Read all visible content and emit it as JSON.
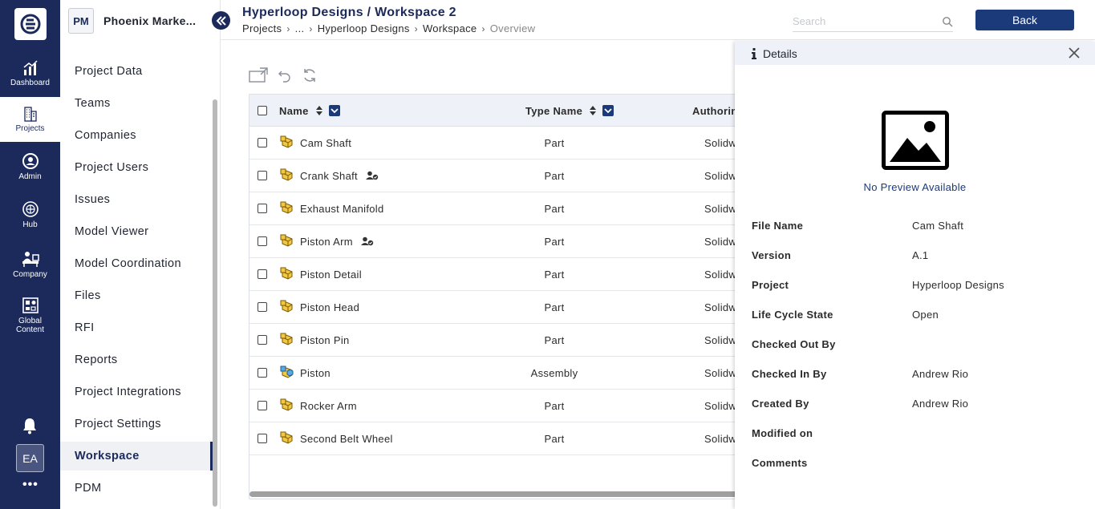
{
  "rail": {
    "items": [
      {
        "label": "Dashboard",
        "icon": "chart-icon"
      },
      {
        "label": "Projects",
        "icon": "building-icon"
      },
      {
        "label": "Admin",
        "icon": "admin-icon"
      },
      {
        "label": "Hub",
        "icon": "globe-icon"
      },
      {
        "label": "Company",
        "icon": "company-icon"
      },
      {
        "label": "Global Content",
        "icon": "grid-icon"
      }
    ],
    "avatar": "EA",
    "more": "•••"
  },
  "project": {
    "initials": "PM",
    "name": "Phoenix Marke..."
  },
  "nav": {
    "items": [
      "Project Data",
      "Teams",
      "Companies",
      "Project Users",
      "Issues",
      "Model Viewer",
      "Model Coordination",
      "Files",
      "RFI",
      "Reports",
      "Project Integrations",
      "Project Settings",
      "Workspace",
      "PDM"
    ],
    "active": "Workspace"
  },
  "header": {
    "title": "Hyperloop Designs / Workspace 2",
    "breadcrumb": [
      "Projects",
      "...",
      "Hyperloop Designs",
      "Workspace",
      "Overview"
    ],
    "search_placeholder": "Search",
    "back_label": "Back"
  },
  "table": {
    "columns": [
      "Name",
      "Type Name",
      "Authoring"
    ],
    "rows": [
      {
        "name": "Cam Shaft",
        "type": "Part",
        "authoring": "Solidw",
        "checked_out": false,
        "kind": "part"
      },
      {
        "name": "Crank Shaft",
        "type": "Part",
        "authoring": "Solidw",
        "checked_out": true,
        "kind": "part"
      },
      {
        "name": "Exhaust Manifold",
        "type": "Part",
        "authoring": "Solidw",
        "checked_out": false,
        "kind": "part"
      },
      {
        "name": "Piston Arm",
        "type": "Part",
        "authoring": "Solidw",
        "checked_out": true,
        "kind": "part"
      },
      {
        "name": "Piston Detail",
        "type": "Part",
        "authoring": "Solidw",
        "checked_out": false,
        "kind": "part"
      },
      {
        "name": "Piston Head",
        "type": "Part",
        "authoring": "Solidw",
        "checked_out": false,
        "kind": "part"
      },
      {
        "name": "Piston Pin",
        "type": "Part",
        "authoring": "Solidw",
        "checked_out": false,
        "kind": "part"
      },
      {
        "name": "Piston",
        "type": "Assembly",
        "authoring": "Solidw",
        "checked_out": false,
        "kind": "assembly"
      },
      {
        "name": "Rocker Arm",
        "type": "Part",
        "authoring": "Solidw",
        "checked_out": false,
        "kind": "part"
      },
      {
        "name": "Second Belt Wheel",
        "type": "Part",
        "authoring": "Solidw",
        "checked_out": false,
        "kind": "part"
      }
    ]
  },
  "details": {
    "title": "Details",
    "no_preview": "No Preview Available",
    "fields": [
      {
        "label": "File Name",
        "value": "Cam Shaft"
      },
      {
        "label": "Version",
        "value": "A.1"
      },
      {
        "label": "Project",
        "value": "Hyperloop Designs"
      },
      {
        "label": "Life Cycle State",
        "value": "Open"
      },
      {
        "label": "Checked Out By",
        "value": ""
      },
      {
        "label": "Checked In By",
        "value": "Andrew Rio"
      },
      {
        "label": "Created By",
        "value": "Andrew Rio"
      },
      {
        "label": "Modified on",
        "value": ""
      },
      {
        "label": "Comments",
        "value": ""
      }
    ]
  }
}
